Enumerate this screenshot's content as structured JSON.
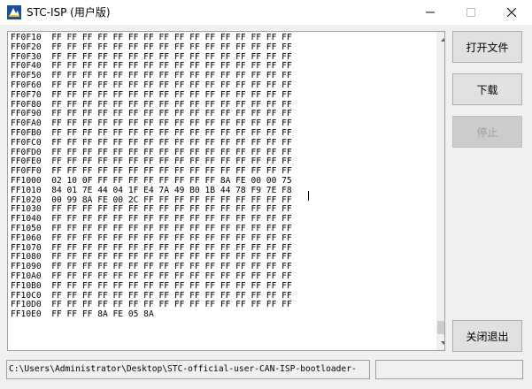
{
  "window": {
    "title": "STC-ISP (用户版)",
    "icons": {
      "app": "stc-app-icon",
      "minimize": "minimize-icon",
      "maximize": "maximize-icon",
      "close": "close-icon"
    }
  },
  "hex_lines": [
    "FF0F10  FF FF FF FF FF FF FF FF FF FF FF FF FF FF FF FF",
    "FF0F20  FF FF FF FF FF FF FF FF FF FF FF FF FF FF FF FF",
    "FF0F30  FF FF FF FF FF FF FF FF FF FF FF FF FF FF FF FF",
    "FF0F40  FF FF FF FF FF FF FF FF FF FF FF FF FF FF FF FF",
    "FF0F50  FF FF FF FF FF FF FF FF FF FF FF FF FF FF FF FF",
    "FF0F60  FF FF FF FF FF FF FF FF FF FF FF FF FF FF FF FF",
    "FF0F70  FF FF FF FF FF FF FF FF FF FF FF FF FF FF FF FF",
    "FF0F80  FF FF FF FF FF FF FF FF FF FF FF FF FF FF FF FF",
    "FF0F90  FF FF FF FF FF FF FF FF FF FF FF FF FF FF FF FF",
    "FF0FA0  FF FF FF FF FF FF FF FF FF FF FF FF FF FF FF FF",
    "FF0FB0  FF FF FF FF FF FF FF FF FF FF FF FF FF FF FF FF",
    "FF0FC0  FF FF FF FF FF FF FF FF FF FF FF FF FF FF FF FF",
    "FF0FD0  FF FF FF FF FF FF FF FF FF FF FF FF FF FF FF FF",
    "FF0FE0  FF FF FF FF FF FF FF FF FF FF FF FF FF FF FF FF",
    "FF0FF0  FF FF FF FF FF FF FF FF FF FF FF FF FF FF FF FF",
    "FF1000  02 10 0F FF FF FF FF FF FF FF FF 8A FE 00 00 75",
    "FF1010  84 01 7E 44 04 1F E4 7A 49 B0 1B 44 78 F9 7E F8",
    "FF1020  00 99 8A FE 00 2C FF FF FF FF FF FF FF FF FF FF",
    "FF1030  FF FF FF FF FF FF FF FF FF FF FF FF FF FF FF FF",
    "FF1040  FF FF FF FF FF FF FF FF FF FF FF FF FF FF FF FF",
    "FF1050  FF FF FF FF FF FF FF FF FF FF FF FF FF FF FF FF",
    "FF1060  FF FF FF FF FF FF FF FF FF FF FF FF FF FF FF FF",
    "FF1070  FF FF FF FF FF FF FF FF FF FF FF FF FF FF FF FF",
    "FF1080  FF FF FF FF FF FF FF FF FF FF FF FF FF FF FF FF",
    "FF1090  FF FF FF FF FF FF FF FF FF FF FF FF FF FF FF FF",
    "FF10A0  FF FF FF FF FF FF FF FF FF FF FF FF FF FF FF FF",
    "FF10B0  FF FF FF FF FF FF FF FF FF FF FF FF FF FF FF FF",
    "FF10C0  FF FF FF FF FF FF FF FF FF FF FF FF FF FF FF FF",
    "FF10D0  FF FF FF FF FF FF FF FF FF FF FF FF FF FF FF FF",
    "FF10E0  FF FF FF 8A FE 05 8A"
  ],
  "buttons": {
    "open_file": "打开文件",
    "download": "下载",
    "stop": "停止",
    "close_exit": "关闭退出"
  },
  "status": {
    "path": "C:\\Users\\Administrator\\Desktop\\STC-official-user-CAN-ISP-bootloader-"
  },
  "colors": {
    "window_bg": "#f0f0f0",
    "titlebar_bg": "#ffffff",
    "button_bg": "#e1e1e1",
    "disabled_text": "#a0a0a0"
  }
}
